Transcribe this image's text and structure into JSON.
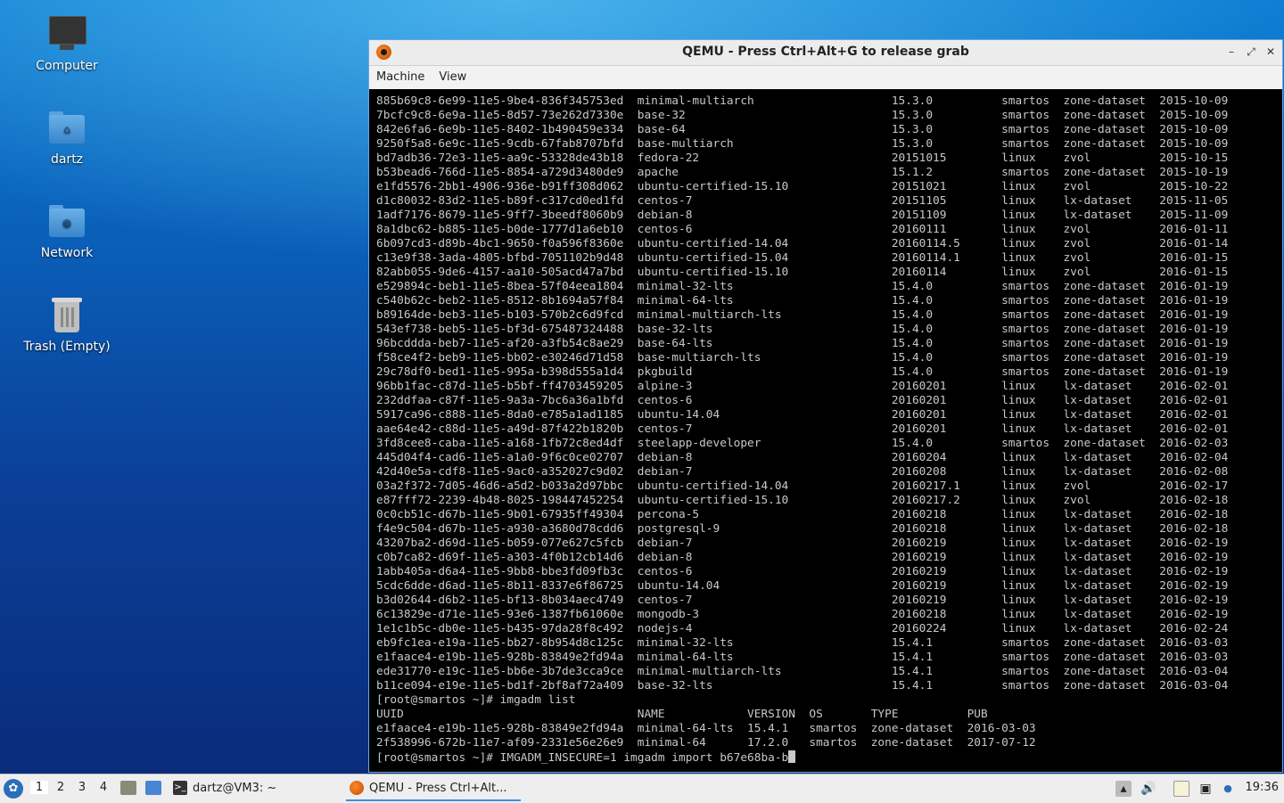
{
  "desktop": {
    "icons": [
      {
        "label": "Computer",
        "icon": "monitor-icon"
      },
      {
        "label": "dartz",
        "icon": "home-folder-icon"
      },
      {
        "label": "Network",
        "icon": "network-folder-icon"
      },
      {
        "label": "Trash (Empty)",
        "icon": "trash-icon"
      }
    ]
  },
  "window": {
    "title": "QEMU - Press Ctrl+Alt+G to release grab",
    "controls": {
      "minimize": "–",
      "maximize": "⤢",
      "close": "✕"
    },
    "menu": [
      "Machine",
      "View"
    ]
  },
  "console": {
    "lines": [
      "885b69c8-6e99-11e5-9be4-836f345753ed  minimal-multiarch                    15.3.0          smartos  zone-dataset  2015-10-09",
      "7bcfc9c8-6e9a-11e5-8d57-73e262d7330e  base-32                              15.3.0          smartos  zone-dataset  2015-10-09",
      "842e6fa6-6e9b-11e5-8402-1b490459e334  base-64                              15.3.0          smartos  zone-dataset  2015-10-09",
      "9250f5a8-6e9c-11e5-9cdb-67fab8707bfd  base-multiarch                       15.3.0          smartos  zone-dataset  2015-10-09",
      "bd7adb36-72e3-11e5-aa9c-53328de43b18  fedora-22                            20151015        linux    zvol          2015-10-15",
      "b53bead6-766d-11e5-8854-a729d3480de9  apache                               15.1.2          smartos  zone-dataset  2015-10-19",
      "e1fd5576-2bb1-4906-936e-b91ff308d062  ubuntu-certified-15.10               20151021        linux    zvol          2015-10-22",
      "d1c80032-83d2-11e5-b89f-c317cd0ed1fd  centos-7                             20151105        linux    lx-dataset    2015-11-05",
      "1adf7176-8679-11e5-9ff7-3beedf8060b9  debian-8                             20151109        linux    lx-dataset    2015-11-09",
      "8a1dbc62-b885-11e5-b0de-1777d1a6eb10  centos-6                             20160111        linux    zvol          2016-01-11",
      "6b097cd3-d89b-4bc1-9650-f0a596f8360e  ubuntu-certified-14.04               20160114.5      linux    zvol          2016-01-14",
      "c13e9f38-3ada-4805-bfbd-7051102b9d48  ubuntu-certified-15.04               20160114.1      linux    zvol          2016-01-15",
      "82abb055-9de6-4157-aa10-505acd47a7bd  ubuntu-certified-15.10               20160114        linux    zvol          2016-01-15",
      "e529894c-beb1-11e5-8bea-57f04eea1804  minimal-32-lts                       15.4.0          smartos  zone-dataset  2016-01-19",
      "c540b62c-beb2-11e5-8512-8b1694a57f84  minimal-64-lts                       15.4.0          smartos  zone-dataset  2016-01-19",
      "b89164de-beb3-11e5-b103-570b2c6d9fcd  minimal-multiarch-lts                15.4.0          smartos  zone-dataset  2016-01-19",
      "543ef738-beb5-11e5-bf3d-675487324488  base-32-lts                          15.4.0          smartos  zone-dataset  2016-01-19",
      "96bcddda-beb7-11e5-af20-a3fb54c8ae29  base-64-lts                          15.4.0          smartos  zone-dataset  2016-01-19",
      "f58ce4f2-beb9-11e5-bb02-e30246d71d58  base-multiarch-lts                   15.4.0          smartos  zone-dataset  2016-01-19",
      "29c78df0-bed1-11e5-995a-b398d555a1d4  pkgbuild                             15.4.0          smartos  zone-dataset  2016-01-19",
      "96bb1fac-c87d-11e5-b5bf-ff4703459205  alpine-3                             20160201        linux    lx-dataset    2016-02-01",
      "232ddfaa-c87f-11e5-9a3a-7bc6a36a1bfd  centos-6                             20160201        linux    lx-dataset    2016-02-01",
      "5917ca96-c888-11e5-8da0-e785a1ad1185  ubuntu-14.04                         20160201        linux    lx-dataset    2016-02-01",
      "aae64e42-c88d-11e5-a49d-87f422b1820b  centos-7                             20160201        linux    lx-dataset    2016-02-01",
      "3fd8cee8-caba-11e5-a168-1fb72c8ed4df  steelapp-developer                   15.4.0          smartos  zone-dataset  2016-02-03",
      "445d04f4-cad6-11e5-a1a0-9f6c0ce02707  debian-8                             20160204        linux    lx-dataset    2016-02-04",
      "42d40e5a-cdf8-11e5-9ac0-a352027c9d02  debian-7                             20160208        linux    lx-dataset    2016-02-08",
      "03a2f372-7d05-46d6-a5d2-b033a2d97bbc  ubuntu-certified-14.04               20160217.1      linux    zvol          2016-02-17",
      "e87fff72-2239-4b48-8025-198447452254  ubuntu-certified-15.10               20160217.2      linux    zvol          2016-02-18",
      "0c0cb51c-d67b-11e5-9b01-67935ff49304  percona-5                            20160218        linux    lx-dataset    2016-02-18",
      "f4e9c504-d67b-11e5-a930-a3680d78cdd6  postgresql-9                         20160218        linux    lx-dataset    2016-02-18",
      "43207ba2-d69d-11e5-b059-077e627c5fcb  debian-7                             20160219        linux    lx-dataset    2016-02-19",
      "c0b7ca82-d69f-11e5-a303-4f0b12cb14d6  debian-8                             20160219        linux    lx-dataset    2016-02-19",
      "1abb405a-d6a4-11e5-9bb8-bbe3fd09fb3c  centos-6                             20160219        linux    lx-dataset    2016-02-19",
      "5cdc6dde-d6ad-11e5-8b11-8337e6f86725  ubuntu-14.04                         20160219        linux    lx-dataset    2016-02-19",
      "b3d02644-d6b2-11e5-bf13-8b034aec4749  centos-7                             20160219        linux    lx-dataset    2016-02-19",
      "6c13829e-d71e-11e5-93e6-1387fb61060e  mongodb-3                            20160218        linux    lx-dataset    2016-02-19",
      "1e1c1b5c-db0e-11e5-b435-97da28f8c492  nodejs-4                             20160224        linux    lx-dataset    2016-02-24",
      "eb9fc1ea-e19a-11e5-bb27-8b954d8c125c  minimal-32-lts                       15.4.1          smartos  zone-dataset  2016-03-03",
      "e1faace4-e19b-11e5-928b-83849e2fd94a  minimal-64-lts                       15.4.1          smartos  zone-dataset  2016-03-03",
      "ede31770-e19c-11e5-bb6e-3b7de3cca9ce  minimal-multiarch-lts                15.4.1          smartos  zone-dataset  2016-03-04",
      "b11ce094-e19e-11e5-bd1f-2bf8af72a409  base-32-lts                          15.4.1          smartos  zone-dataset  2016-03-04",
      "[root@smartos ~]# imgadm list",
      "UUID                                  NAME            VERSION  OS       TYPE          PUB",
      "e1faace4-e19b-11e5-928b-83849e2fd94a  minimal-64-lts  15.4.1   smartos  zone-dataset  2016-03-03",
      "2f538996-672b-11e7-af09-2331e56e26e9  minimal-64      17.2.0   smartos  zone-dataset  2017-07-12"
    ],
    "prompt": "[root@smartos ~]# IMGADM_INSECURE=1 imgadm import b67e68ba-b"
  },
  "taskbar": {
    "start_icon": "lxqt-start-icon",
    "workspaces": [
      "1",
      "2",
      "3",
      "4"
    ],
    "active_workspace": "1",
    "tasks": [
      {
        "label": "dartz@VM3: ~",
        "icon": "terminal-icon"
      },
      {
        "label": "QEMU - Press Ctrl+Alt...",
        "icon": "qemu-icon"
      }
    ],
    "clock": "19:36"
  }
}
